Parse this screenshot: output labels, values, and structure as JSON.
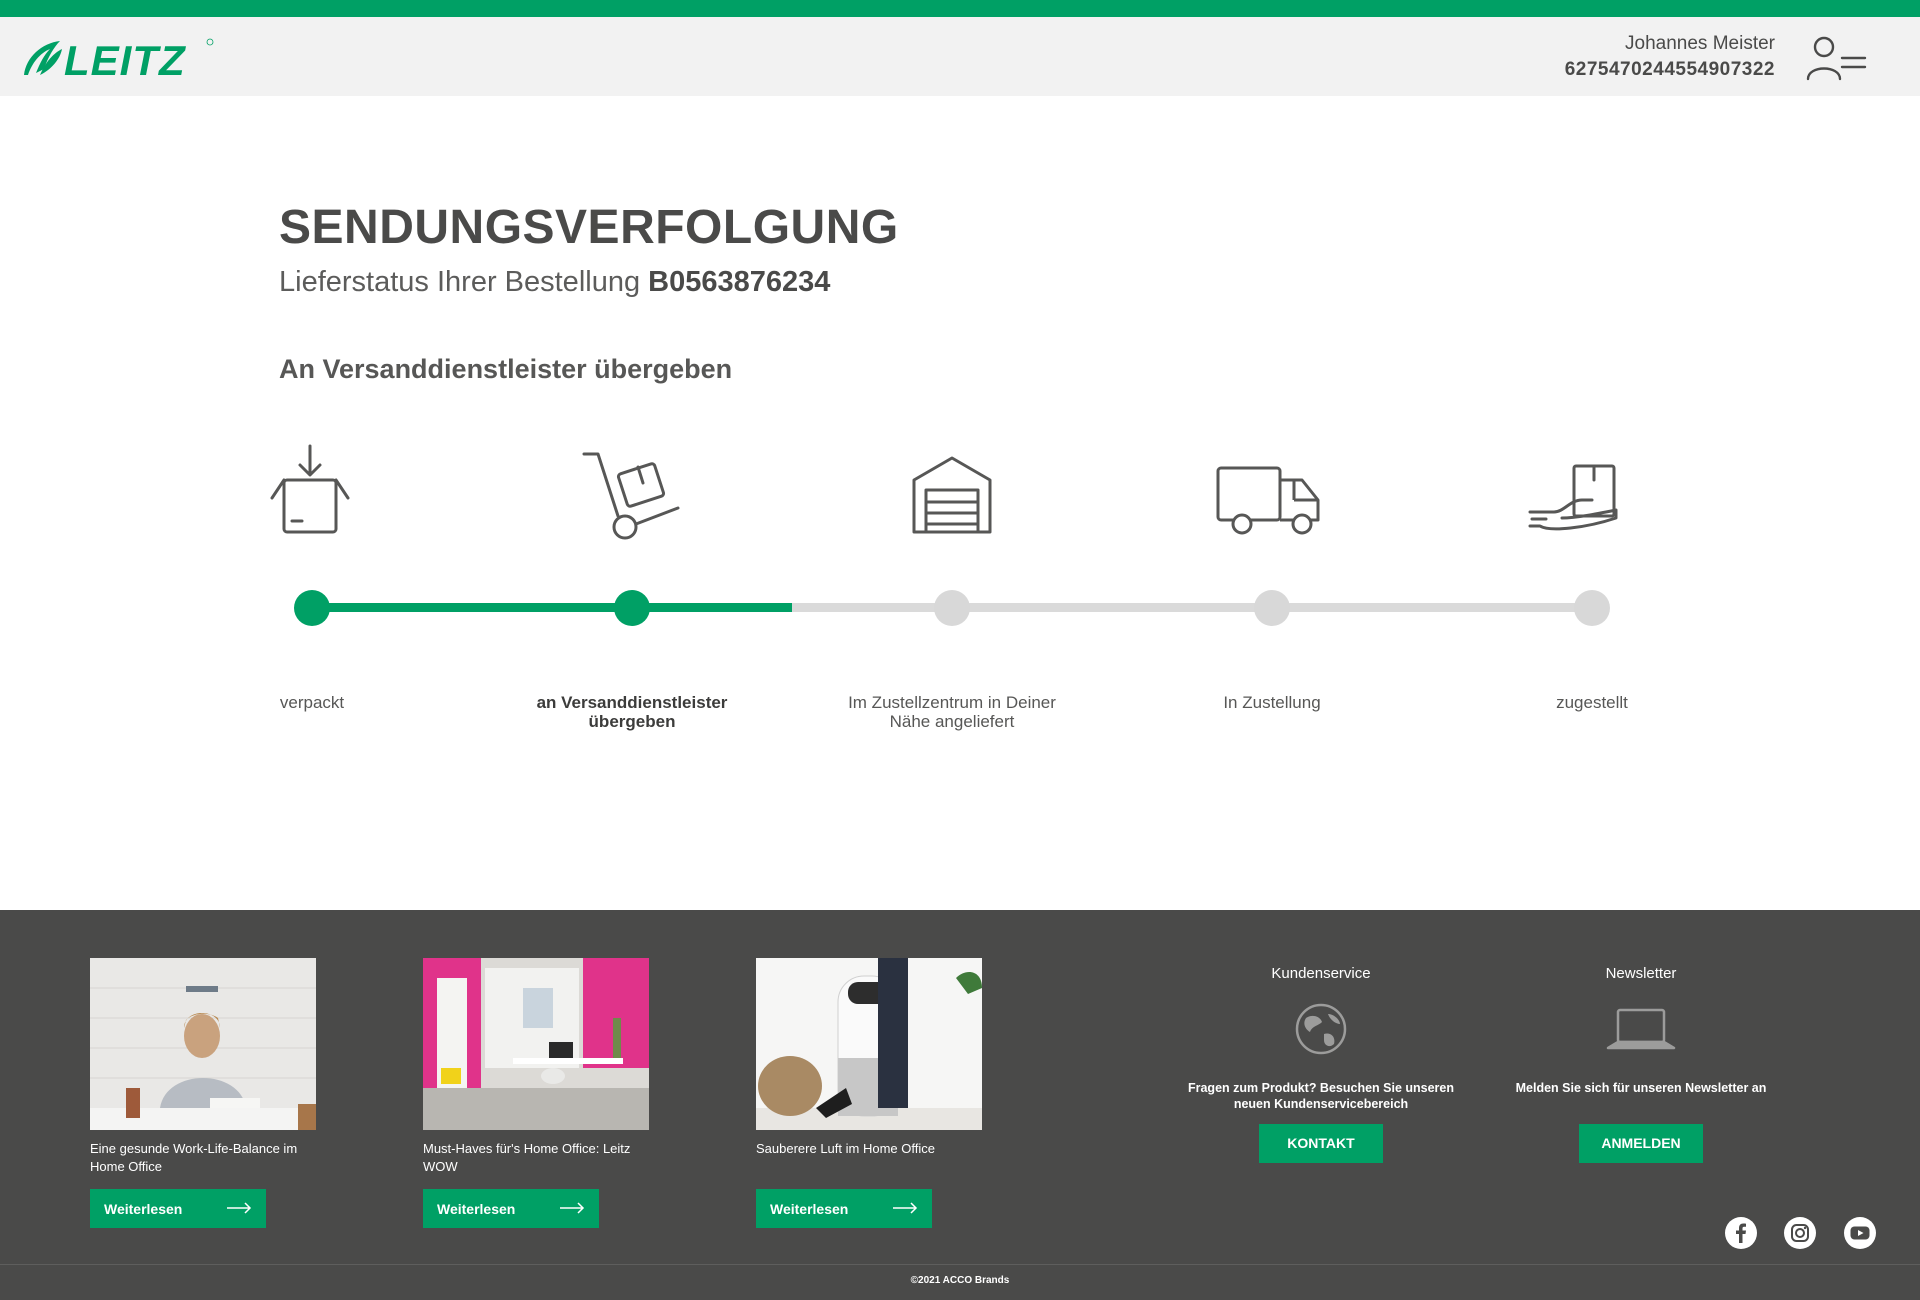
{
  "header": {
    "brand": "LEITZ",
    "user_name": "Johannes Meister",
    "user_number": "6275470244554907322"
  },
  "main": {
    "title": "SENDUNGSVERFOLGUNG",
    "subtitle_prefix": "Lieferstatus Ihrer Bestellung ",
    "order_number": "B0563876234",
    "current_status": "An Versanddienstleister übergeben",
    "progress_completed_steps": 2,
    "progress_fraction": 0.375,
    "steps": [
      {
        "label": "verpackt",
        "icon": "box-in-icon",
        "state": "done"
      },
      {
        "label": "an Versanddienstleister übergeben",
        "icon": "hand-truck-icon",
        "state": "current"
      },
      {
        "label": "Im Zustellzentrum in Deiner Nähe angeliefert",
        "icon": "warehouse-icon",
        "state": "pending"
      },
      {
        "label": "In Zustellung",
        "icon": "truck-icon",
        "state": "pending"
      },
      {
        "label": "zugestellt",
        "icon": "hand-package-icon",
        "state": "pending"
      }
    ]
  },
  "footer": {
    "articles": [
      {
        "title": "Eine gesunde Work-Life-Balance im Home Office",
        "button": "Weiterlesen"
      },
      {
        "title": "Must-Haves für's Home Office: Leitz WOW",
        "button": "Weiterlesen"
      },
      {
        "title": "Sauberere Luft im Home Office",
        "button": "Weiterlesen"
      }
    ],
    "customer_service": {
      "title": "Kundenservice",
      "text": "Fragen zum Produkt? Besuchen Sie unseren neuen Kundenservicebereich",
      "button": "KONTAKT",
      "icon": "globe-icon"
    },
    "newsletter": {
      "title": "Newsletter",
      "text": "Melden Sie sich für unseren Newsletter an",
      "button": "ANMELDEN",
      "icon": "laptop-icon"
    },
    "social": [
      "facebook-icon",
      "instagram-icon",
      "youtube-icon"
    ],
    "copyright": "©2021 ACCO Brands"
  },
  "colors": {
    "brand_green": "#00a065",
    "inactive_grey": "#d8d8d8",
    "footer_bg": "#4a4a49",
    "header_bg": "#f2f2f2"
  }
}
